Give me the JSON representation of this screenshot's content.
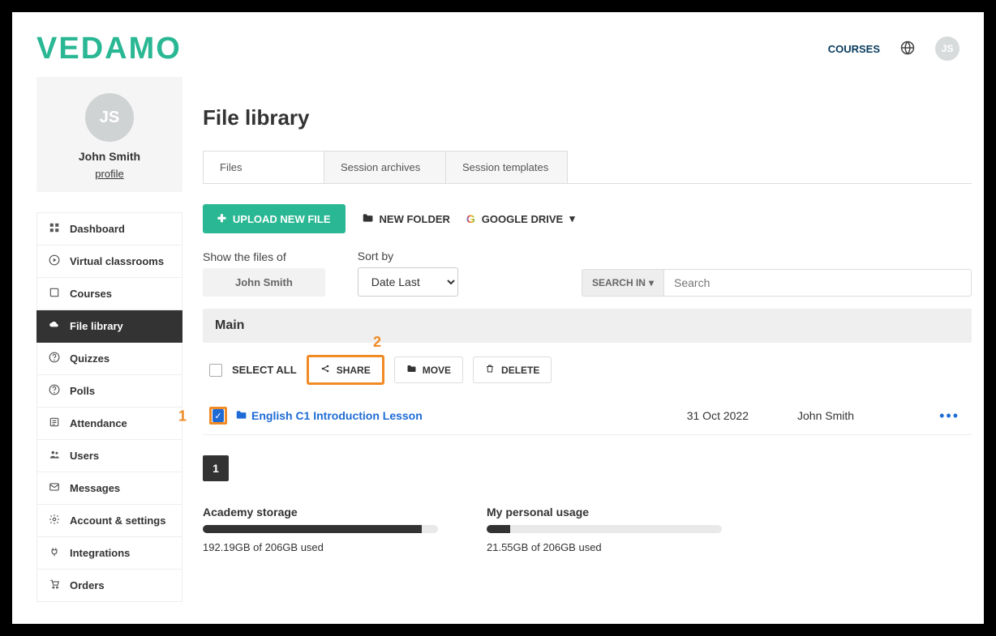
{
  "header": {
    "logo": "VEDAMO",
    "courses_link": "COURSES",
    "avatar_initials": "JS"
  },
  "profile": {
    "avatar_initials": "JS",
    "name": "John Smith",
    "profile_link": "profile"
  },
  "nav": {
    "items": [
      {
        "label": "Dashboard"
      },
      {
        "label": "Virtual classrooms"
      },
      {
        "label": "Courses"
      },
      {
        "label": "File library"
      },
      {
        "label": "Quizzes"
      },
      {
        "label": "Polls"
      },
      {
        "label": "Attendance"
      },
      {
        "label": "Users"
      },
      {
        "label": "Messages"
      },
      {
        "label": "Account & settings"
      },
      {
        "label": "Integrations"
      },
      {
        "label": "Orders"
      }
    ]
  },
  "page": {
    "title": "File library"
  },
  "tabs": {
    "items": [
      {
        "label": "Files"
      },
      {
        "label": "Session archives"
      },
      {
        "label": "Session templates"
      }
    ]
  },
  "toolbar": {
    "upload": "UPLOAD NEW FILE",
    "new_folder": "NEW FOLDER",
    "google_drive": "GOOGLE DRIVE"
  },
  "filters": {
    "show_label": "Show the files of",
    "show_value": "John Smith",
    "sort_label": "Sort by",
    "sort_value": "Date Last",
    "search_in": "SEARCH IN",
    "search_placeholder": "Search"
  },
  "folder": {
    "name": "Main"
  },
  "actions": {
    "select_all": "SELECT ALL",
    "share": "SHARE",
    "move": "MOVE",
    "delete": "DELETE"
  },
  "callouts": {
    "one": "1",
    "two": "2"
  },
  "files": {
    "items": [
      {
        "name": "English C1 Introduction Lesson",
        "date": "31 Oct 2022",
        "owner": "John Smith"
      }
    ]
  },
  "pagination": {
    "page": "1"
  },
  "storage": {
    "academy_label": "Academy storage",
    "academy_text": "192.19GB of 206GB used",
    "academy_pct": 93,
    "personal_label": "My personal usage",
    "personal_text": "21.55GB of 206GB used",
    "personal_pct": 10
  }
}
